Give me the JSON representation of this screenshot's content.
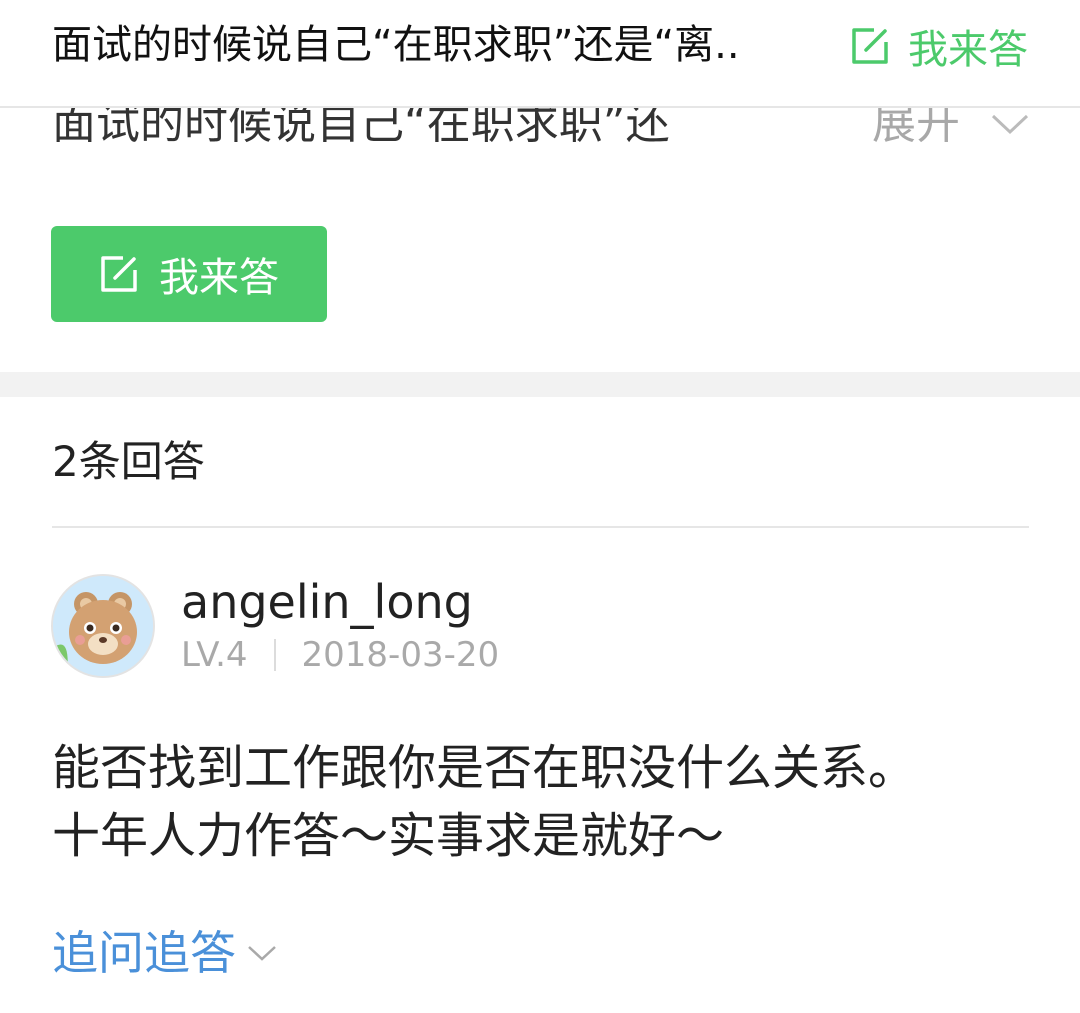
{
  "header": {
    "title": "面试的时候说自己“在职求职”还是“离..",
    "answer_label": "我来答"
  },
  "question": {
    "preview": "面试的时候说自己“在职求职”还",
    "expand_label": "展开"
  },
  "answer_button": {
    "label": "我来答"
  },
  "answers": {
    "count_label": "2条回答",
    "items": [
      {
        "username": "angelin_long",
        "level": "LV.4",
        "date": "2018-03-20",
        "lines": [
          "能否找到工作跟你是否在职没什么关系。",
          "十年人力作答～实事求是就好～"
        ],
        "followup_label": "追问追答"
      }
    ]
  },
  "colors": {
    "brand_green": "#4cca6b",
    "link_blue": "#4a90d9",
    "muted_gray": "#a9a9a9",
    "band_gray": "#f2f2f2"
  },
  "icons": {
    "answer": "edit-icon",
    "expand": "chevron-down-icon",
    "followup": "chevron-down-icon"
  }
}
